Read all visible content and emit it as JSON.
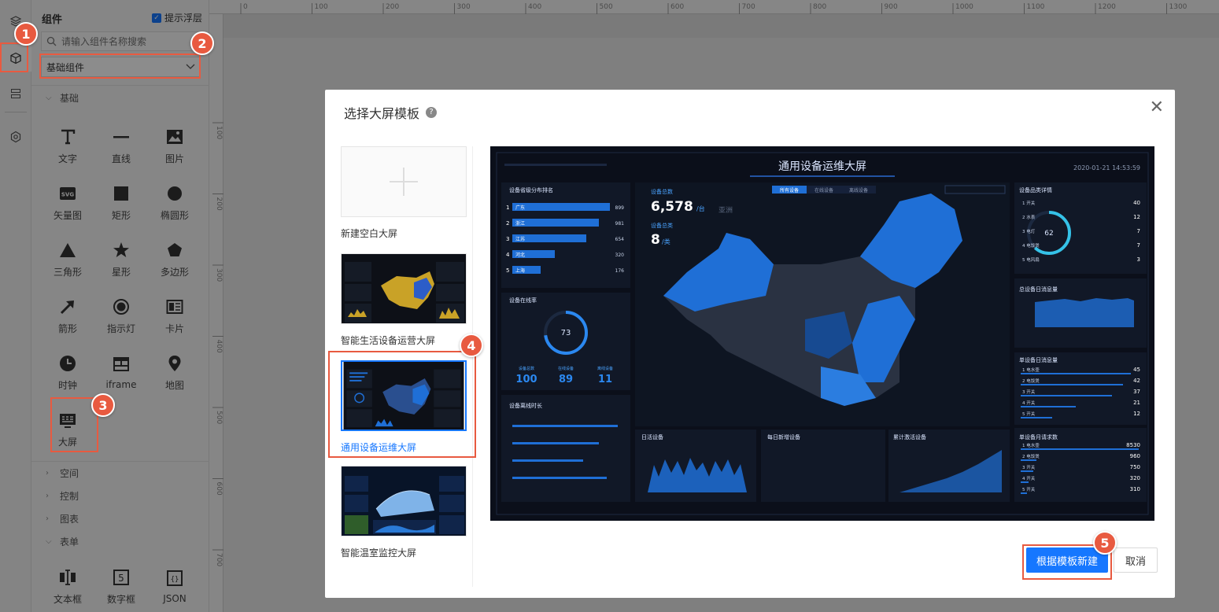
{
  "panel": {
    "title": "组件",
    "float_tip_label": "提示浮层",
    "search_placeholder": "请输入组件名称搜索",
    "select_value": "基础组件",
    "category_basic": "基础",
    "categories_collapsed": [
      "空间",
      "控制",
      "图表"
    ],
    "category_form": "表单",
    "components": [
      "文字",
      "直线",
      "图片",
      "矢量图",
      "矩形",
      "椭圆形",
      "三角形",
      "星形",
      "多边形",
      "箭形",
      "指示灯",
      "卡片",
      "时钟",
      "iframe",
      "地图",
      "大屏"
    ],
    "form_components": [
      "文本框",
      "数字框",
      "JSON"
    ]
  },
  "ruler": {
    "top_ticks": [
      "0",
      "100",
      "200",
      "300",
      "400",
      "500",
      "600",
      "700",
      "800",
      "900",
      "1000",
      "1100",
      "1200",
      "1300"
    ],
    "left_ticks": [
      "100",
      "200",
      "300",
      "400",
      "500",
      "600",
      "700"
    ]
  },
  "modal": {
    "title": "选择大屏模板",
    "templates": [
      {
        "label": "新建空白大屏"
      },
      {
        "label": "智能生活设备运营大屏"
      },
      {
        "label": "通用设备运维大屏"
      },
      {
        "label": "智能温室监控大屏"
      }
    ],
    "confirm_label": "根据模板新建",
    "cancel_label": "取消"
  },
  "dashboard": {
    "title": "通用设备运维大屏",
    "datetime": "2020-01-21 14:53:59",
    "rank_title": "设备省级分布排名",
    "rank_rows": [
      {
        "n": "1",
        "name": "广东",
        "v": "899"
      },
      {
        "n": "2",
        "name": "浙江",
        "v": "981"
      },
      {
        "n": "3",
        "name": "江苏",
        "v": "654"
      },
      {
        "n": "4",
        "name": "河北",
        "v": "320"
      },
      {
        "n": "5",
        "name": "上海",
        "v": "176"
      }
    ],
    "total_label": "设备总数",
    "total_value": "6,578",
    "total_unit": "/台",
    "types_label": "设备总类",
    "types_value": "8",
    "types_unit": "/类",
    "tabs": [
      "所有设备",
      "在线设备",
      "离线设备"
    ],
    "online_title": "设备在线率",
    "online_pct": "73",
    "online_stats": [
      {
        "l": "设备总数",
        "v": "100"
      },
      {
        "l": "在线设备",
        "v": "89"
      },
      {
        "l": "离线设备",
        "v": "11"
      }
    ],
    "offline_title": "设备离线时长",
    "detail_title": "设备品类详情",
    "detail_pct": "62",
    "detail_rows": [
      {
        "n": "1",
        "name": "开关",
        "v": "40"
      },
      {
        "n": "2",
        "name": "水表",
        "v": "12"
      },
      {
        "n": "3",
        "name": "电灯",
        "v": "7"
      },
      {
        "n": "4",
        "name": "电饭煲",
        "v": "7"
      },
      {
        "n": "5",
        "name": "电风扇",
        "v": "3"
      }
    ],
    "daily_title": "总设备日消息量",
    "single_title": "单设备日消息量",
    "single_rows": [
      {
        "n": "1",
        "name": "电水壶",
        "v": "45"
      },
      {
        "n": "2",
        "name": "电饭煲",
        "v": "42"
      },
      {
        "n": "3",
        "name": "开关",
        "v": "37"
      },
      {
        "n": "4",
        "name": "开关",
        "v": "21"
      },
      {
        "n": "5",
        "name": "开关",
        "v": "12"
      }
    ],
    "monthly_title": "单设备月请求数",
    "monthly_rows": [
      {
        "n": "1",
        "name": "电水壶",
        "v": "8530"
      },
      {
        "n": "2",
        "name": "电饭煲",
        "v": "960"
      },
      {
        "n": "3",
        "name": "开关",
        "v": "750"
      },
      {
        "n": "4",
        "name": "开关",
        "v": "320"
      },
      {
        "n": "5",
        "name": "开关",
        "v": "310"
      }
    ],
    "bottom_titles": [
      "日活设备",
      "每日新增设备",
      "累计激活设备"
    ],
    "asia_label": "亚洲"
  },
  "annotations": [
    "1",
    "2",
    "3",
    "4",
    "5"
  ],
  "colors": {
    "accent": "#1677ff",
    "highlight": "#e85a40",
    "dash_bg": "#0b0f1a",
    "map_blue": "#1f6fd6"
  }
}
